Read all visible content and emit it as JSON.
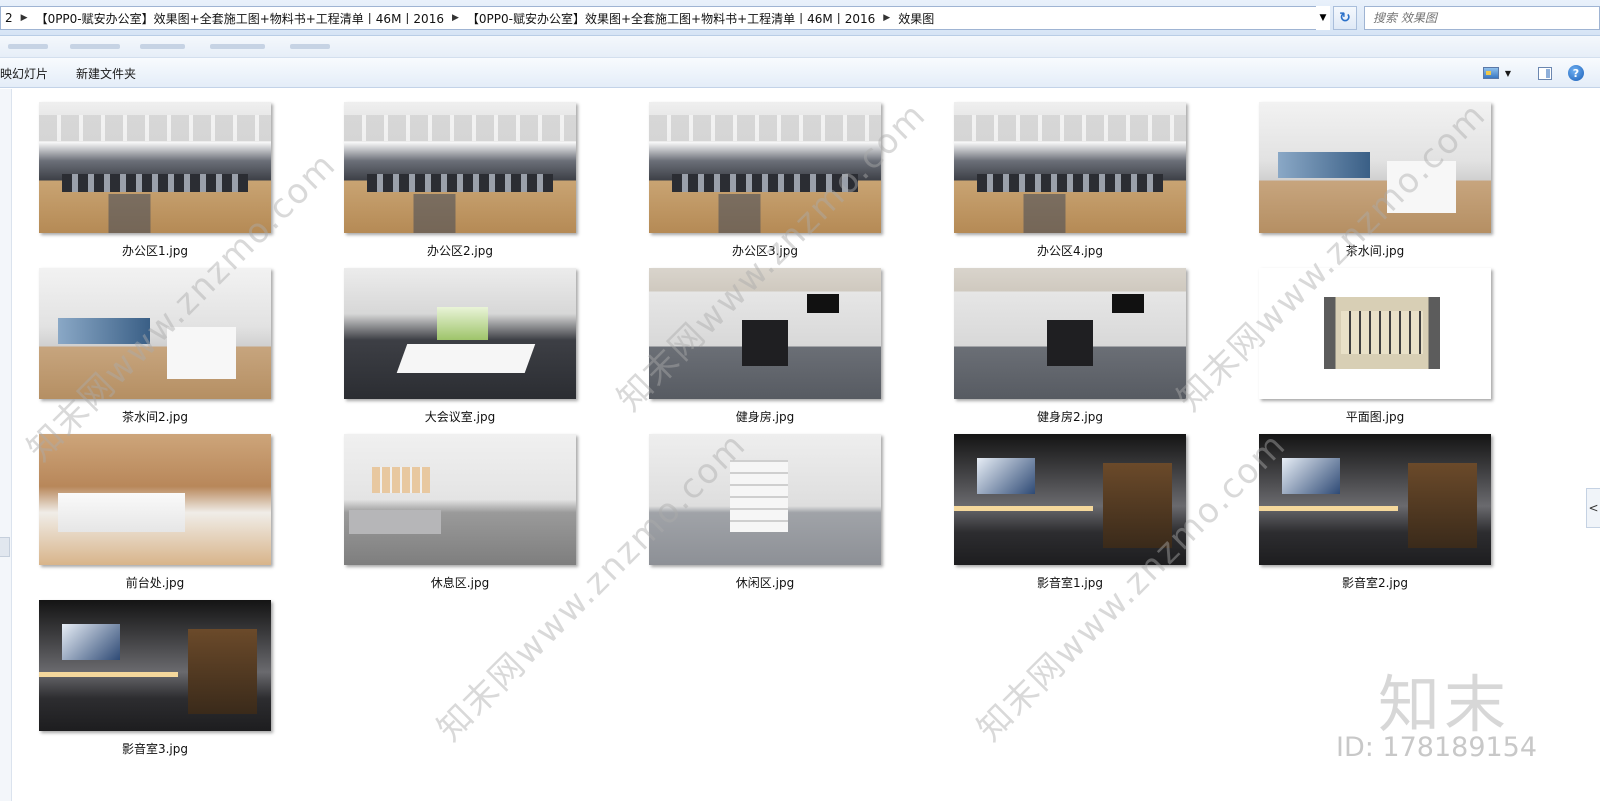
{
  "address_bar": {
    "segments": [
      "2",
      "【0PP0-赋安办公室】效果图+全套施工图+物料书+工程清单丨46M丨2016",
      "【0PP0-赋安办公室】效果图+全套施工图+物料书+工程清单丨46M丨2016",
      "效果图"
    ],
    "search_placeholder": "搜索 效果图"
  },
  "toolbar": {
    "slideshow_label": "映幻灯片",
    "new_folder_label": "新建文件夹"
  },
  "files": [
    {
      "name": "办公区1.jpg",
      "thumb": "office"
    },
    {
      "name": "办公区2.jpg",
      "thumb": "office"
    },
    {
      "name": "办公区3.jpg",
      "thumb": "office"
    },
    {
      "name": "办公区4.jpg",
      "thumb": "office"
    },
    {
      "name": "茶水间.jpg",
      "thumb": "tea"
    },
    {
      "name": "茶水间2.jpg",
      "thumb": "tea"
    },
    {
      "name": "大会议室.jpg",
      "thumb": "meeting"
    },
    {
      "name": "健身房.jpg",
      "thumb": "gym"
    },
    {
      "name": "健身房2.jpg",
      "thumb": "gym"
    },
    {
      "name": "平面图.jpg",
      "thumb": "plan"
    },
    {
      "name": "前台处.jpg",
      "thumb": "reception"
    },
    {
      "name": "休息区.jpg",
      "thumb": "lounge"
    },
    {
      "name": "休闲区.jpg",
      "thumb": "leisure"
    },
    {
      "name": "影音室1.jpg",
      "thumb": "av"
    },
    {
      "name": "影音室2.jpg",
      "thumb": "av"
    },
    {
      "name": "影音室3.jpg",
      "thumb": "av"
    }
  ],
  "watermark": {
    "text": "知末网www.znzmo.com",
    "brand": "知末",
    "id": "ID: 178189154"
  },
  "colors": {
    "chrome_light": "#e9f1fb",
    "chrome_dark": "#d6e4f5",
    "accent": "#2a70c9"
  }
}
